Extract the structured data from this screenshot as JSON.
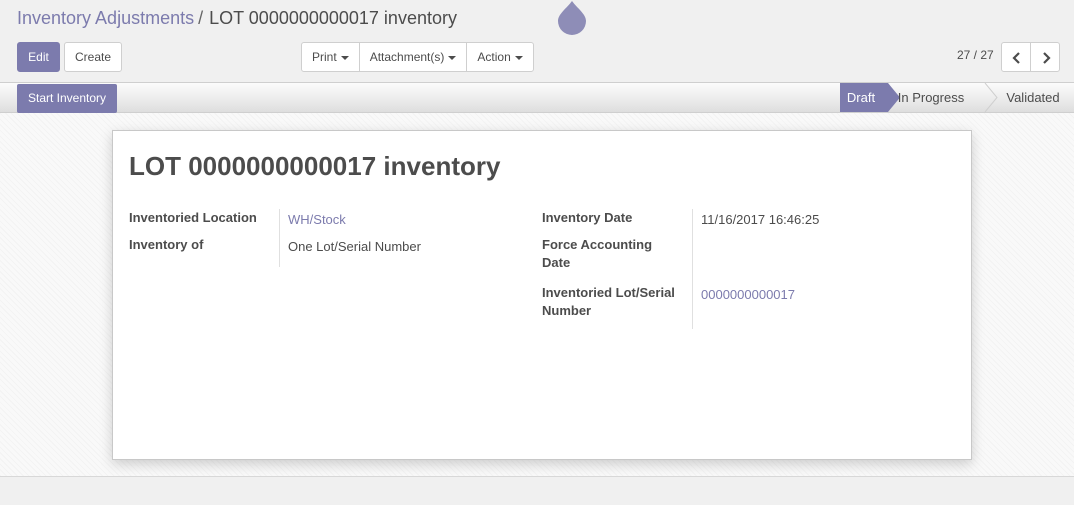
{
  "breadcrumb": {
    "parent": "Inventory Adjustments",
    "separator": "/",
    "current": "LOT 0000000000017 inventory"
  },
  "buttons": {
    "edit": "Edit",
    "create": "Create",
    "print": "Print",
    "attachments": "Attachment(s)",
    "action": "Action"
  },
  "pager": {
    "value": "27 / 27"
  },
  "header": {
    "start_button": "Start Inventory",
    "stages": [
      {
        "label": "Draft",
        "active": true
      },
      {
        "label": "In Progress",
        "active": false
      },
      {
        "label": "Validated",
        "active": false
      }
    ]
  },
  "record": {
    "title": "LOT 0000000000017 inventory",
    "left": {
      "location_label": "Inventoried Location",
      "location_value": "WH/Stock",
      "inventory_of_label": "Inventory of",
      "inventory_of_value": "One Lot/Serial Number"
    },
    "right": {
      "date_label": "Inventory Date",
      "date_value": "11/16/2017 16:46:25",
      "force_date_label_line1": "Force Accounting",
      "force_date_label_line2": "Date",
      "lot_label_line1": "Inventoried Lot/Serial",
      "lot_label_line2": "Number",
      "lot_value": "0000000000017"
    }
  },
  "colors": {
    "brand": "#7c7bad",
    "text": "#4c4c4c"
  }
}
